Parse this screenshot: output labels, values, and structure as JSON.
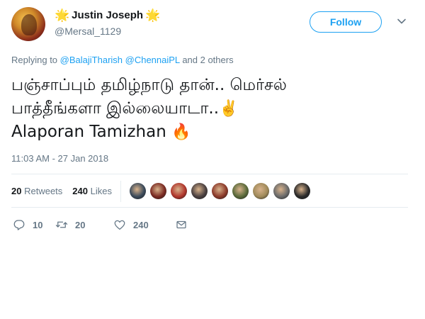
{
  "user": {
    "display_name": "Justin Joseph",
    "handle": "@Mersal_1129",
    "name_decoration": "🌟"
  },
  "follow_label": "Follow",
  "replying": {
    "prefix": "Replying to",
    "mentions": [
      "@BalajiTharish",
      "@ChennaiPL"
    ],
    "suffix": "and 2 others"
  },
  "tweet": {
    "line1": "பஞ்சாப்பும் தமிழ்நாடு தான்.. மெர்சல்",
    "line2": "பாத்தீங்களா இல்லையாடா..",
    "line2_emoji": "✌️",
    "line3": "Alaporan Tamizhan",
    "line3_emoji": "🔥"
  },
  "timestamp": "11:03 AM - 27 Jan 2018",
  "stats": {
    "retweets_count": "20",
    "retweets_label": "Retweets",
    "likes_count": "240",
    "likes_label": "Likes"
  },
  "liker_colors": [
    "#3b4a5a",
    "#7a2a22",
    "#b0362c",
    "#4a4040",
    "#8c3a2a",
    "#5a6a3a",
    "#a08a5a",
    "#6a6a6a",
    "#2a2a2a"
  ],
  "actions": {
    "reply_count": "10",
    "retweet_count": "20",
    "like_count": "240"
  },
  "icons": {
    "caret": "chevron-down-icon",
    "reply": "reply-icon",
    "retweet": "retweet-icon",
    "like": "heart-icon",
    "message": "envelope-icon"
  },
  "colors": {
    "accent": "#1da1f2",
    "muted": "#657786",
    "text": "#14171a"
  }
}
